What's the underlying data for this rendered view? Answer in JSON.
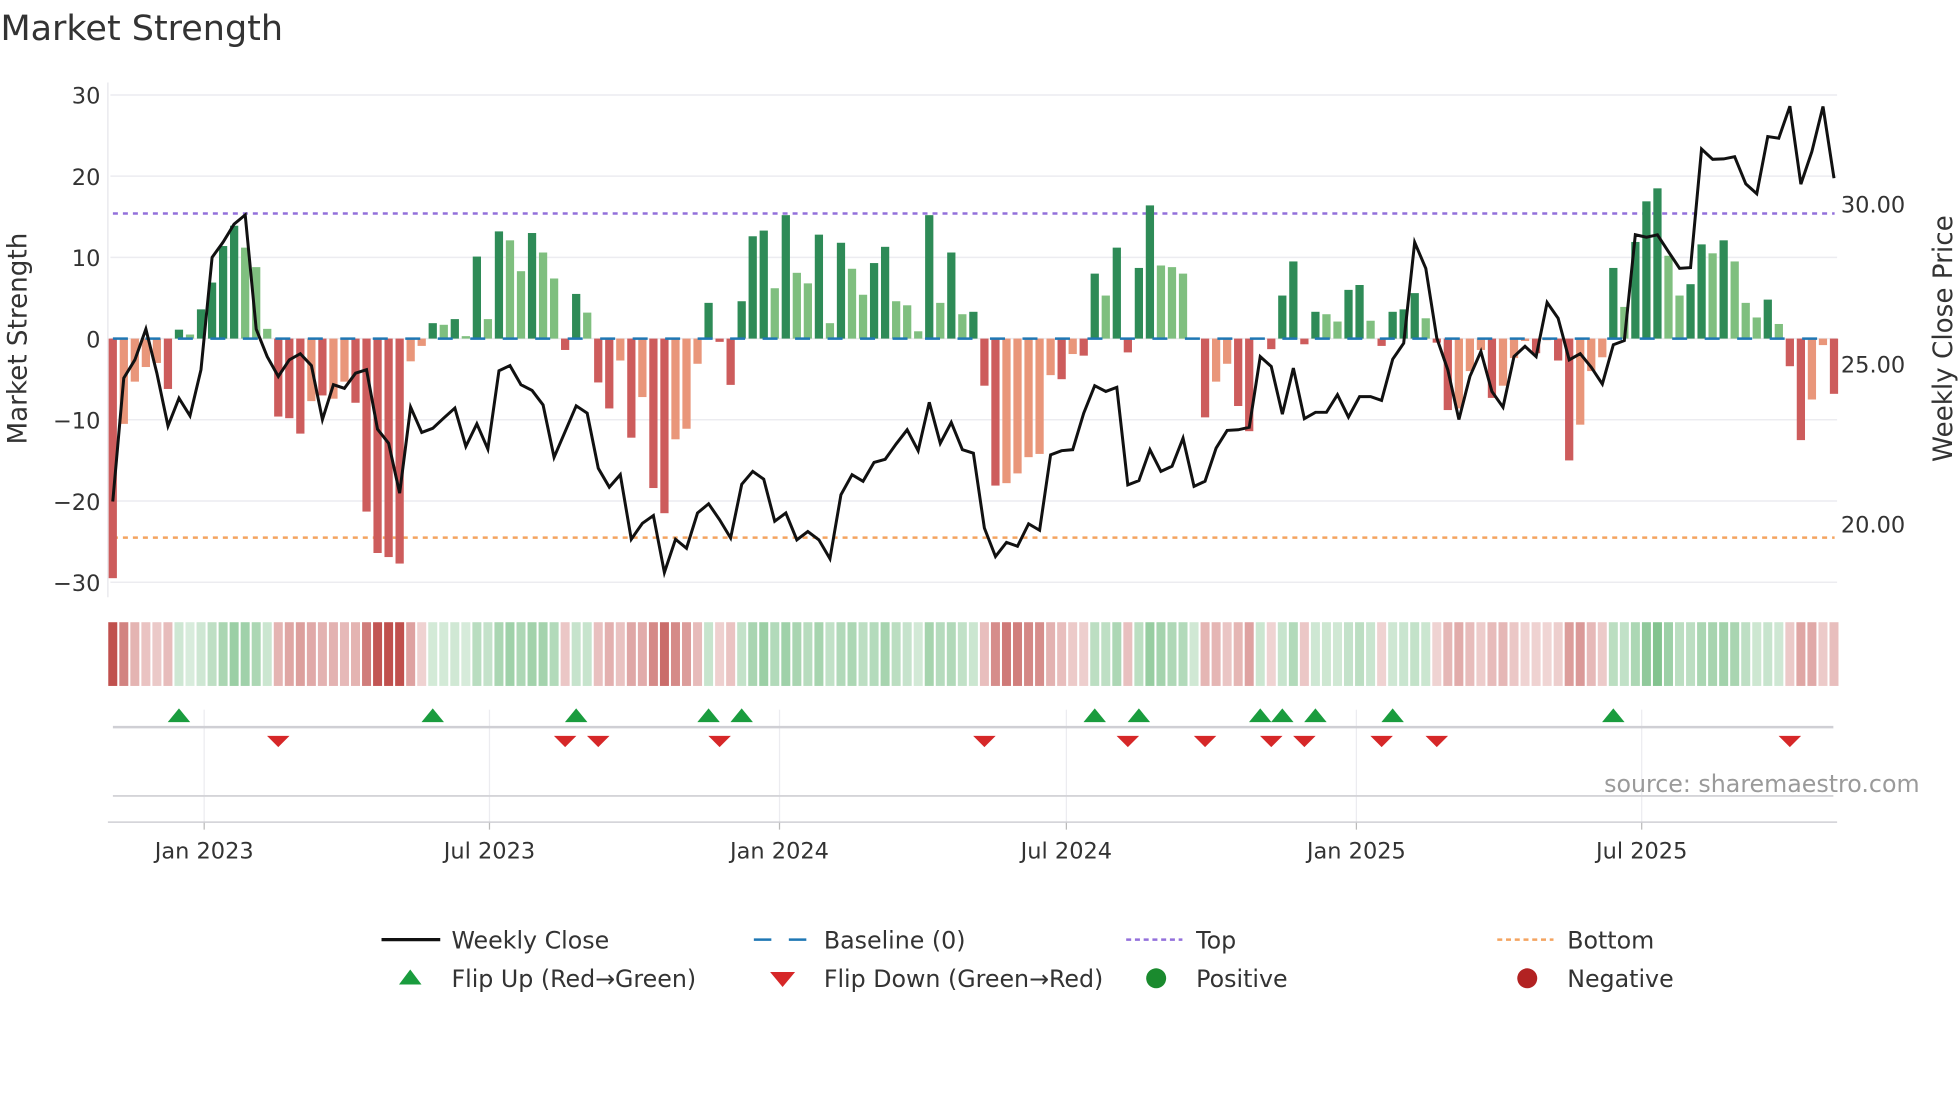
{
  "chart_data": {
    "type": "bar",
    "title": "Market Strength",
    "ylabel": "Market Strength",
    "y2label": "Weekly Close Price",
    "ylim": [
      -31.8,
      31.6
    ],
    "y2lim": [
      18.05,
      34.14
    ],
    "yticks": [
      30,
      20,
      10,
      0,
      -10,
      -20,
      -30
    ],
    "ytick_labels": [
      "30",
      "20",
      "10",
      "0",
      "−10",
      "−20",
      "−30"
    ],
    "y2ticks": [
      30,
      25,
      20
    ],
    "y2tick_labels": [
      "30.00",
      "25.00",
      "20.00"
    ],
    "x_start": "2022-11-04",
    "x_step_days": 7,
    "xticks": [
      {
        "date": "2023-01-01",
        "label": "Jan 2023"
      },
      {
        "date": "2023-07-01",
        "label": "Jul 2023"
      },
      {
        "date": "2024-01-01",
        "label": "Jan 2024"
      },
      {
        "date": "2024-07-01",
        "label": "Jul 2024"
      },
      {
        "date": "2025-01-01",
        "label": "Jan 2025"
      },
      {
        "date": "2025-07-01",
        "label": "Jul 2025"
      }
    ],
    "top_level": 15.4,
    "bottom_level": -24.5,
    "baseline": 0,
    "strength": [
      -29.5,
      -10.5,
      -5.3,
      -3.5,
      -3.0,
      -6.2,
      1.1,
      0.5,
      3.6,
      6.9,
      11.4,
      13.9,
      11.2,
      8.8,
      1.2,
      -9.6,
      -9.8,
      -11.7,
      -7.7,
      -7.0,
      -7.4,
      -5.3,
      -7.9,
      -21.3,
      -26.4,
      -26.9,
      -27.7,
      -2.8,
      -0.9,
      1.9,
      1.7,
      2.4,
      0.3,
      10.1,
      2.4,
      13.2,
      12.1,
      8.3,
      13.0,
      10.6,
      7.4,
      -1.4,
      5.5,
      3.2,
      -5.4,
      -8.6,
      -2.7,
      -12.2,
      -7.2,
      -18.4,
      -21.5,
      -12.4,
      -11.1,
      -3.1,
      4.4,
      -0.4,
      -5.7,
      4.6,
      12.6,
      13.3,
      6.2,
      15.2,
      8.1,
      6.8,
      12.8,
      1.9,
      11.8,
      8.6,
      5.4,
      9.3,
      11.3,
      4.6,
      4.1,
      0.9,
      15.2,
      4.4,
      10.6,
      3.0,
      3.3,
      -5.8,
      -18.1,
      -17.8,
      -16.6,
      -14.6,
      -14.2,
      -4.5,
      -5.0,
      -1.9,
      -2.1,
      8.0,
      5.3,
      11.2,
      -1.7,
      8.7,
      16.4,
      9.0,
      8.8,
      8.0,
      0,
      -9.7,
      -5.3,
      -3.1,
      -8.3,
      -11.4,
      0.1,
      -1.3,
      5.3,
      9.5,
      -0.7,
      3.3,
      3.0,
      2.1,
      6.0,
      6.6,
      2.2,
      -0.9,
      3.3,
      3.6,
      5.6,
      2.5,
      -0.5,
      -8.8,
      -8.6,
      -4.0,
      -1.4,
      -7.3,
      -5.8,
      -2.4,
      -0.3,
      -1.8,
      -0.2,
      -2.7,
      -15.0,
      -10.6,
      -4.0,
      -2.3,
      8.7,
      3.9,
      11.9,
      16.9,
      18.5,
      10.2,
      5.3,
      6.7,
      11.6,
      10.5,
      12.1,
      9.5,
      4.4,
      2.6,
      4.8,
      1.8,
      -3.4,
      -12.5,
      -7.5,
      -0.8,
      -6.8
    ],
    "shade": "DLLLLDDLDDDDLLLDDDLDLLDDDDDLLDLDLDLDLLDLLDDLDDLDLDDLLLDDDDDDLDLLDLDLLDDLLLDLDLDDDLLLLLDLDDLDDDDLLLLDLLDDLDDDDDLLDDLDDDDLDDLLLDLLLDLDDLLLDLDDDLLDDLDLLLDLDDLLD",
    "weekly_close": [
      21.04,
      24.9,
      25.47,
      26.43,
      25.05,
      23.4,
      24.27,
      23.72,
      25.16,
      28.67,
      29.15,
      29.71,
      30.0,
      26.43,
      25.57,
      24.95,
      25.47,
      25.66,
      25.29,
      23.6,
      24.69,
      24.58,
      25.05,
      25.16,
      23.3,
      22.86,
      21.3,
      23.99,
      23.2,
      23.33,
      23.65,
      23.96,
      22.76,
      23.47,
      22.68,
      25.13,
      25.29,
      24.69,
      24.51,
      24.06,
      22.42,
      23.23,
      24.03,
      23.8,
      22.08,
      21.49,
      21.88,
      19.86,
      20.36,
      20.6,
      18.82,
      19.86,
      19.58,
      20.68,
      20.97,
      20.47,
      19.9,
      21.58,
      21.98,
      21.74,
      20.42,
      20.68,
      19.84,
      20.1,
      19.84,
      19.25,
      21.25,
      21.88,
      21.67,
      22.26,
      22.36,
      22.84,
      23.28,
      22.63,
      24.14,
      22.86,
      23.51,
      22.66,
      22.55,
      20.21,
      19.32,
      19.76,
      19.64,
      20.34,
      20.14,
      22.5,
      22.63,
      22.66,
      23.8,
      24.66,
      24.48,
      24.61,
      21.56,
      21.69,
      22.66,
      21.98,
      22.14,
      23.02,
      21.51,
      21.67,
      22.71,
      23.26,
      23.28,
      23.36,
      25.57,
      25.26,
      23.77,
      25.21,
      23.63,
      23.83,
      23.83,
      24.38,
      23.68,
      24.32,
      24.32,
      24.2,
      25.49,
      25.99,
      29.14,
      28.33,
      26.15,
      25.16,
      23.6,
      24.95,
      25.73,
      24.48,
      23.99,
      25.57,
      25.89,
      25.57,
      27.26,
      26.77,
      25.47,
      25.66,
      25.24,
      24.71,
      25.94,
      26.07,
      29.38,
      29.3,
      29.38,
      28.85,
      28.33,
      28.35,
      32.06,
      31.74,
      31.75,
      31.82,
      30.97,
      30.66,
      32.45,
      32.4,
      33.4,
      30.96,
      31.98,
      33.39,
      31.15
    ],
    "flip_up_weeks": [
      6,
      29,
      42,
      54,
      57,
      89,
      93,
      104,
      106,
      109,
      116,
      136
    ],
    "flip_down_weeks": [
      15,
      41,
      44,
      55,
      79,
      92,
      99,
      105,
      108,
      115,
      120,
      152
    ],
    "legend": [
      {
        "label": "Weekly Close",
        "kind": "line"
      },
      {
        "label": "Baseline (0)",
        "kind": "dash"
      },
      {
        "label": "Top",
        "kind": "dot"
      },
      {
        "label": "Bottom",
        "kind": "dot"
      },
      {
        "label": "Flip Up (Red→Green)",
        "kind": "up"
      },
      {
        "label": "Flip Down (Green→Red)",
        "kind": "down"
      },
      {
        "label": "Positive",
        "kind": "circle"
      },
      {
        "label": "Negative",
        "kind": "circle"
      }
    ],
    "legend_placement": "bottom",
    "grid": true
  },
  "colors": {
    "pos_strong": "#2e8b57",
    "pos_weak": "#7fbf7f",
    "neg_strong": "#cd5c5c",
    "neg_weak": "#e9967a",
    "line": "#111111",
    "baseline": "#1f77b4",
    "top": "#9370db",
    "bottom": "#f4a460",
    "flip_up": "#1a9c3e",
    "flip_down": "#d62728",
    "positive": "#1a8a2e",
    "negative": "#b22222",
    "strip_pos": "#5cb06c",
    "strip_neg": "#c0504d"
  },
  "source": "source: sharemaestro.com"
}
